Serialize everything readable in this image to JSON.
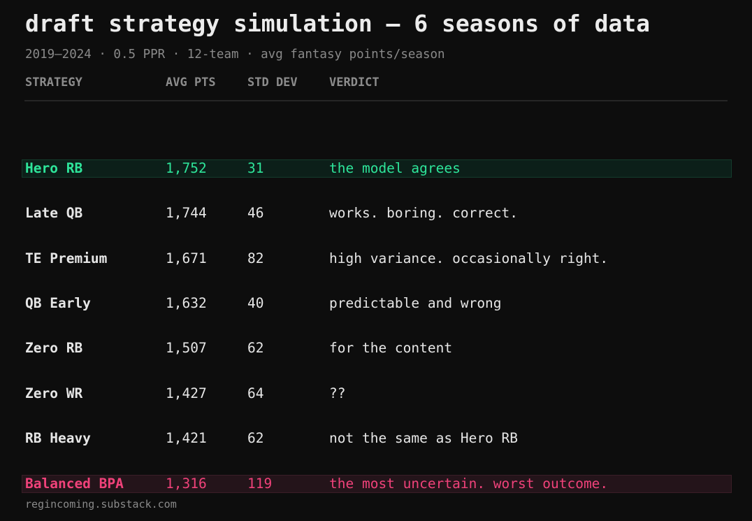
{
  "title": "draft strategy simulation — 6 seasons of data",
  "subtitle": "2019–2024 · 0.5 PPR · 12-team · avg fantasy points/season",
  "columns": {
    "strategy": "STRATEGY",
    "avg_pts": "AVG PTS",
    "std_dev": "STD DEV",
    "verdict": "VERDICT"
  },
  "colors": {
    "background": "#0d0d0d",
    "best": "#2ee59a",
    "worst": "#f0427a",
    "text": "#e6e6e6",
    "muted": "#8a8a8a"
  },
  "rows": [
    {
      "strategy": "Hero RB",
      "avg_pts": "1,752",
      "std_dev": "31",
      "verdict": "the model agrees",
      "status": "best"
    },
    {
      "strategy": "Late QB",
      "avg_pts": "1,744",
      "std_dev": "46",
      "verdict": "works. boring. correct.",
      "status": "normal"
    },
    {
      "strategy": "TE Premium",
      "avg_pts": "1,671",
      "std_dev": "82",
      "verdict": "high variance. occasionally right.",
      "status": "normal"
    },
    {
      "strategy": "QB Early",
      "avg_pts": "1,632",
      "std_dev": "40",
      "verdict": "predictable and wrong",
      "status": "normal"
    },
    {
      "strategy": "Zero RB",
      "avg_pts": "1,507",
      "std_dev": "62",
      "verdict": "for the content",
      "status": "normal"
    },
    {
      "strategy": "Zero WR",
      "avg_pts": "1,427",
      "std_dev": "64",
      "verdict": "??",
      "status": "normal"
    },
    {
      "strategy": "RB Heavy",
      "avg_pts": "1,421",
      "std_dev": "62",
      "verdict": "not the same as Hero RB",
      "status": "normal"
    },
    {
      "strategy": "Balanced BPA",
      "avg_pts": "1,316",
      "std_dev": "119",
      "verdict": "the most uncertain. worst outcome.",
      "status": "worst"
    }
  ],
  "footer": "regincoming.substack.com"
}
